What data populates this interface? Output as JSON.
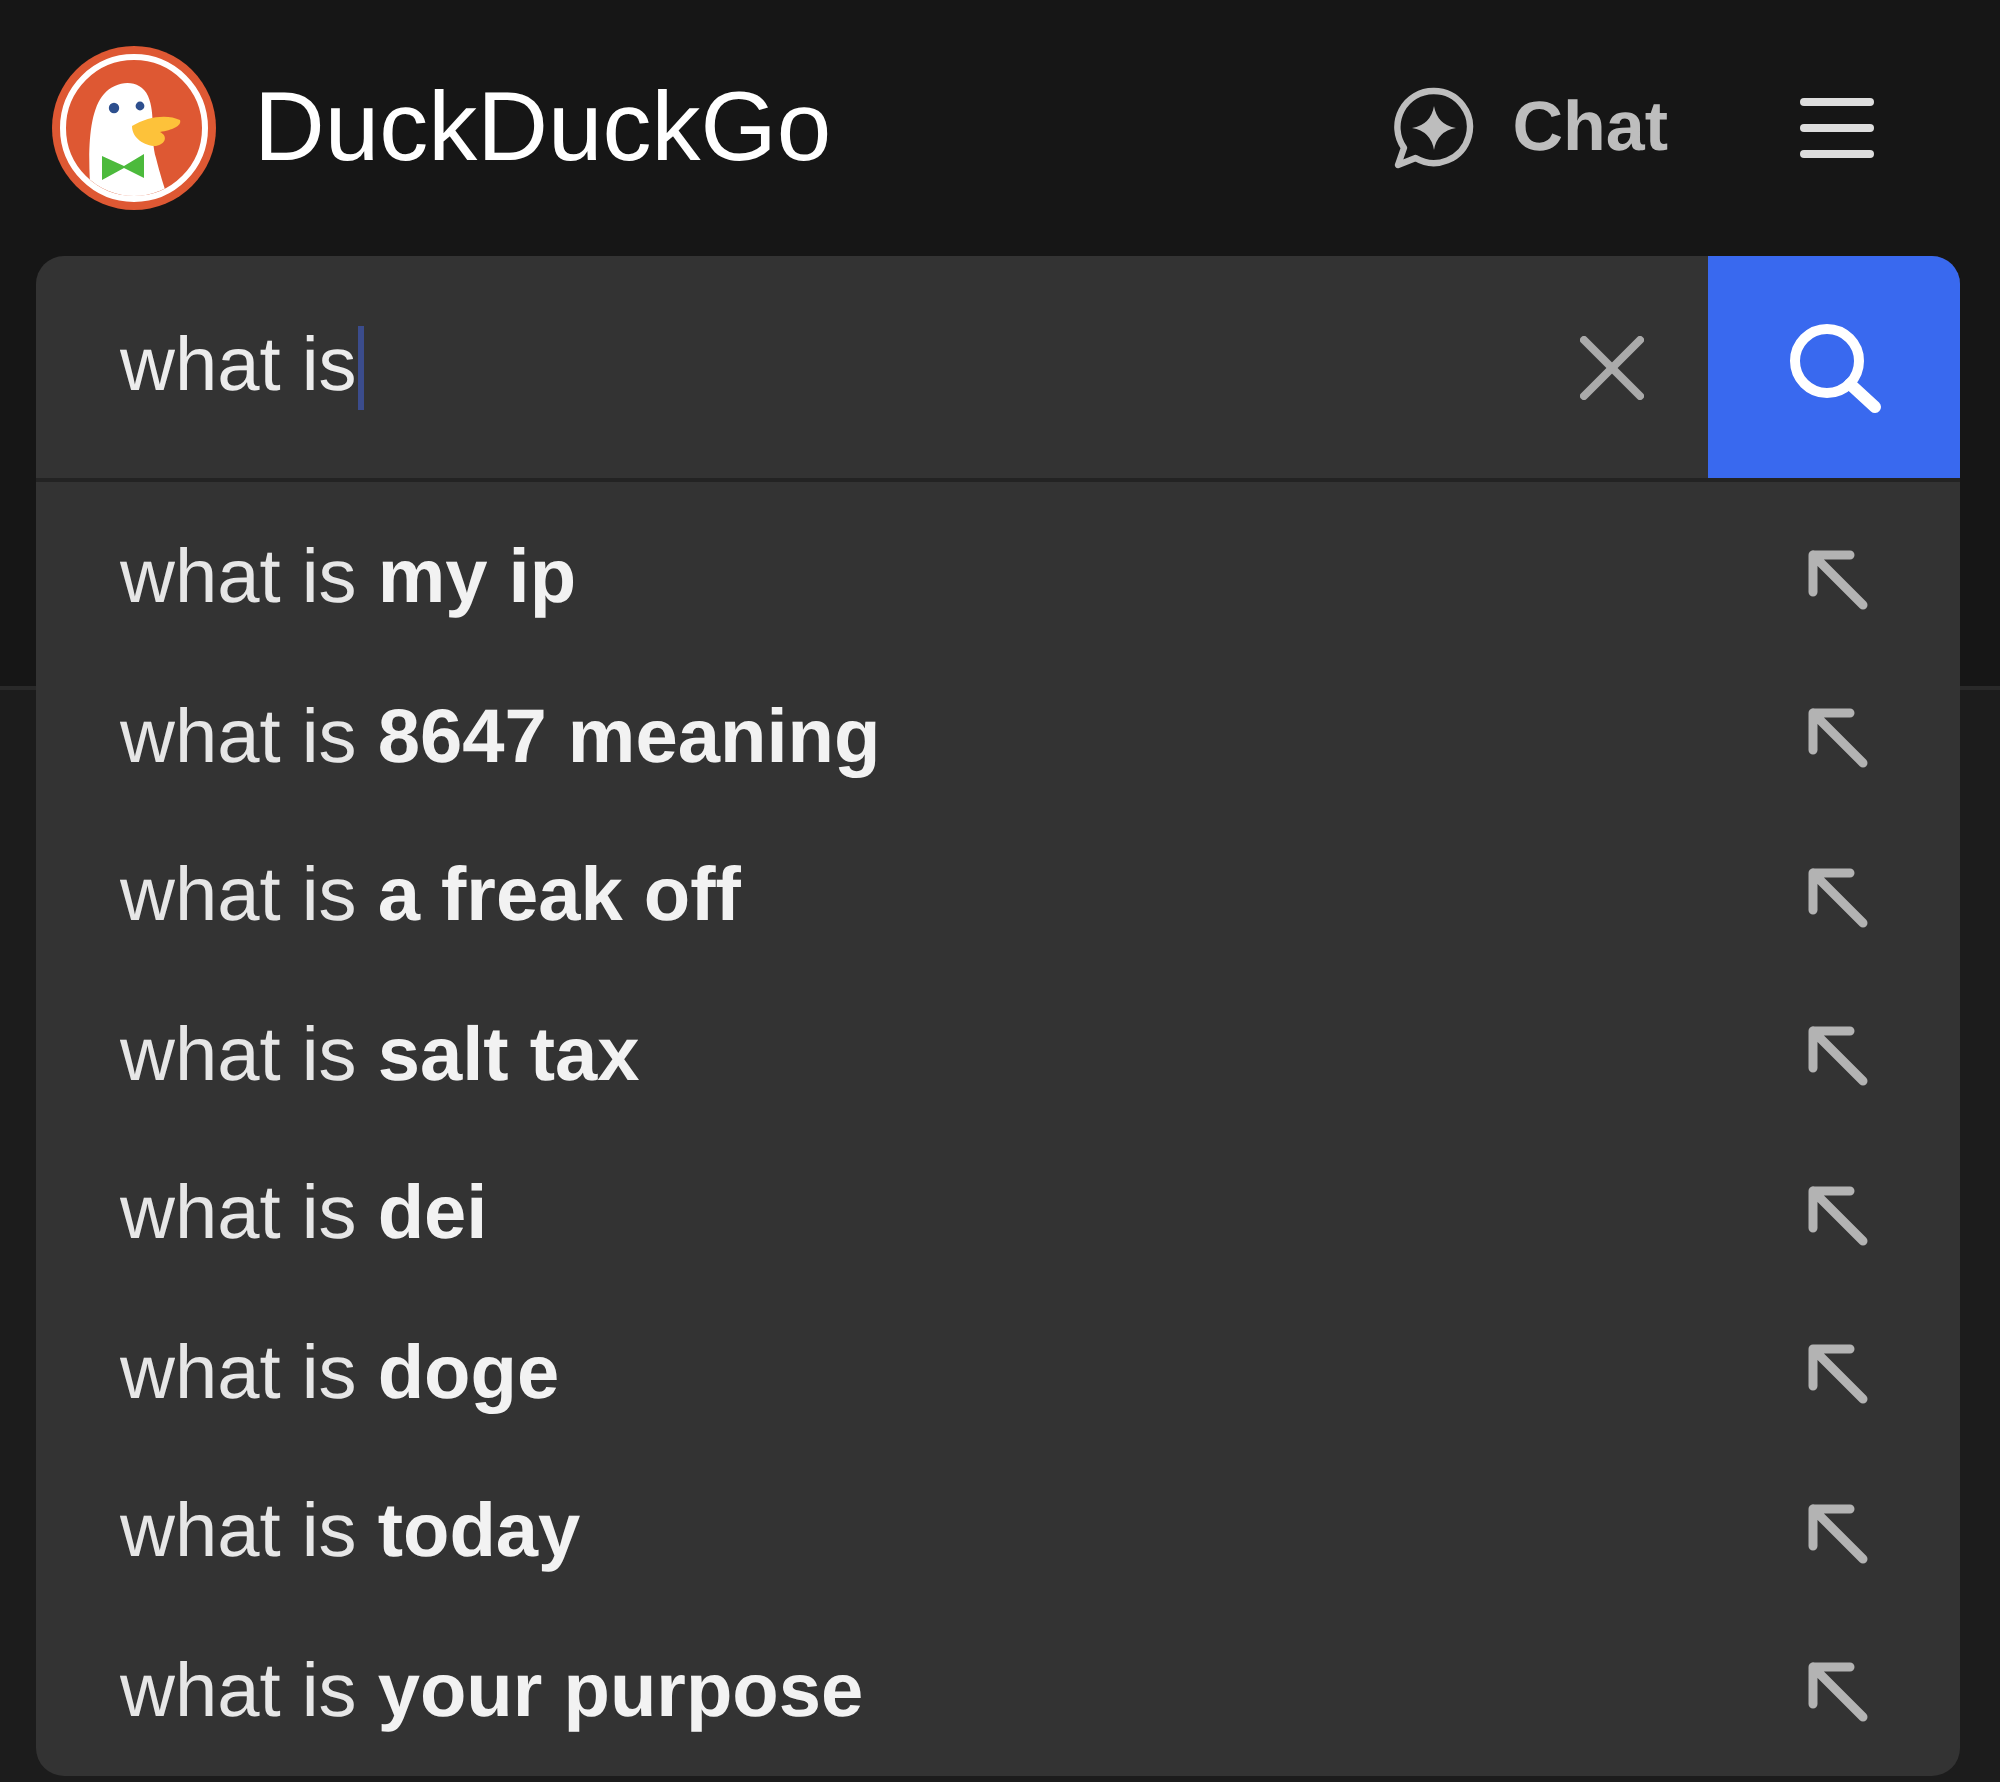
{
  "header": {
    "brand": "DuckDuckGo",
    "chat_label": "Chat"
  },
  "search": {
    "value": "what is"
  },
  "suggestions": [
    {
      "text": "what is **my ip**"
    },
    {
      "text": "what is **8647 meaning**"
    },
    {
      "text": "what is **a freak off**"
    },
    {
      "text": "what is **salt tax**"
    },
    {
      "text": "what is **dei**"
    },
    {
      "text": "what is **doge**"
    },
    {
      "text": "what is **today**"
    },
    {
      "text": "what is **your purpose**"
    }
  ]
}
